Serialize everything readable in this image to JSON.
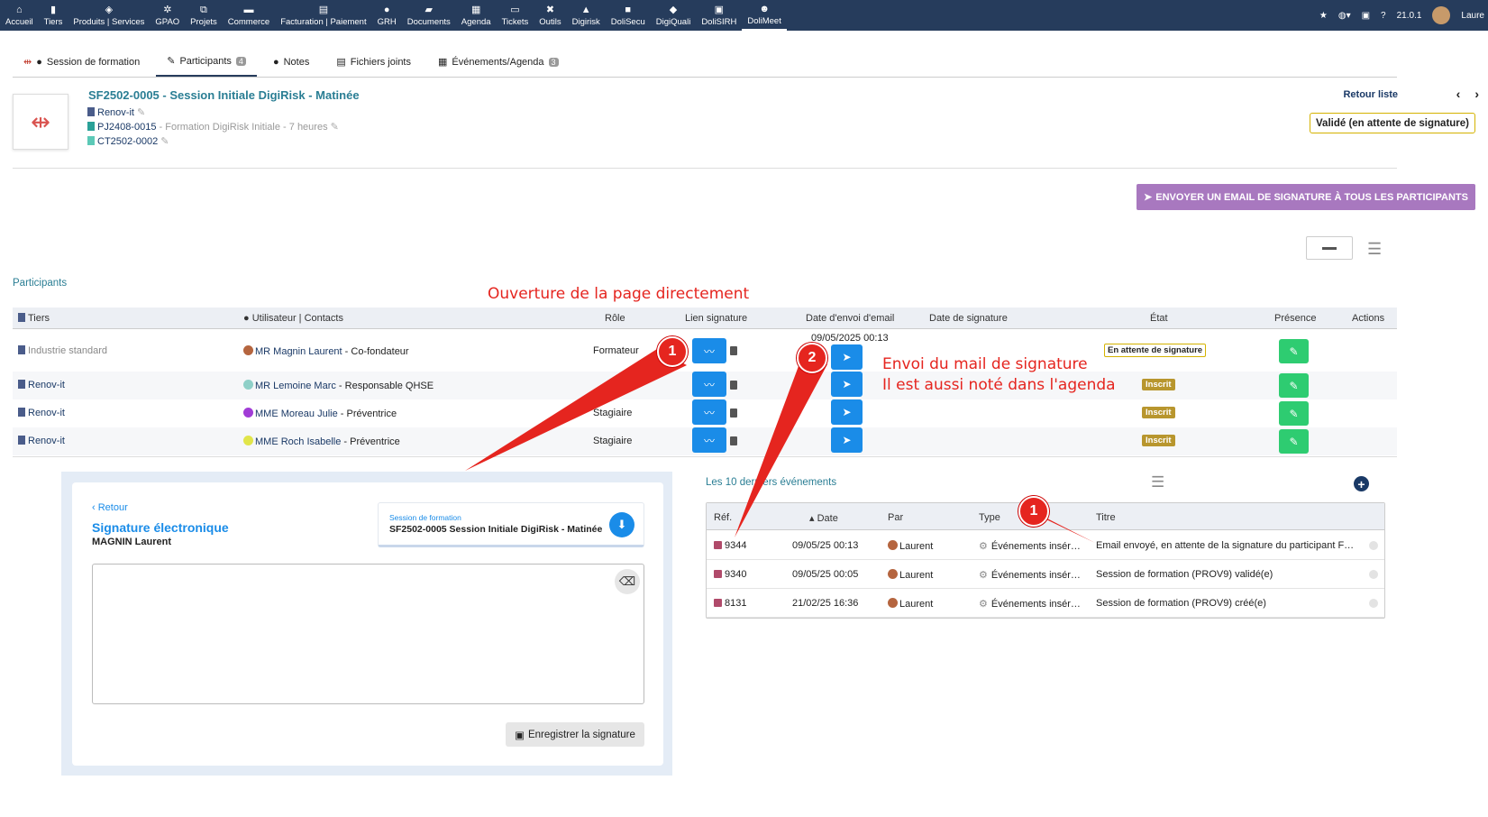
{
  "topbar": {
    "items": [
      {
        "label": "Accueil",
        "icon": "home-icon",
        "glyph": "⌂"
      },
      {
        "label": "Tiers",
        "icon": "building-icon",
        "glyph": "▮"
      },
      {
        "label": "Produits | Services",
        "icon": "cube-icon",
        "glyph": "◈"
      },
      {
        "label": "GPAO",
        "icon": "cogs-icon",
        "glyph": "✲"
      },
      {
        "label": "Projets",
        "icon": "sitemap-icon",
        "glyph": "⧉"
      },
      {
        "label": "Commerce",
        "icon": "briefcase-icon",
        "glyph": "▬"
      },
      {
        "label": "Facturation | Paiement",
        "icon": "file-invoice-icon",
        "glyph": "▤"
      },
      {
        "label": "GRH",
        "icon": "user-tie-icon",
        "glyph": "●"
      },
      {
        "label": "Documents",
        "icon": "folder-icon",
        "glyph": "▰"
      },
      {
        "label": "Agenda",
        "icon": "calendar-icon",
        "glyph": "▦"
      },
      {
        "label": "Tickets",
        "icon": "ticket-icon",
        "glyph": "▭"
      },
      {
        "label": "Outils",
        "icon": "tools-icon",
        "glyph": "✖"
      },
      {
        "label": "Digirisk",
        "icon": "digirisk-icon",
        "glyph": "▲"
      },
      {
        "label": "DoliSecu",
        "icon": "lock-icon",
        "glyph": "■"
      },
      {
        "label": "DigiQuali",
        "icon": "digiquali-icon",
        "glyph": "◆"
      },
      {
        "label": "DoliSIRH",
        "icon": "id-card-icon",
        "glyph": "▣"
      },
      {
        "label": "DoliMeet",
        "icon": "people-icon",
        "glyph": "☻"
      }
    ],
    "version": "21.0.1",
    "user": "Laure"
  },
  "tabs": [
    {
      "label": "Session de formation",
      "badge": ""
    },
    {
      "label": "Participants",
      "badge": "4"
    },
    {
      "label": "Notes",
      "badge": ""
    },
    {
      "label": "Fichiers joints",
      "badge": ""
    },
    {
      "label": "Événements/Agenda",
      "badge": "3"
    }
  ],
  "header": {
    "title": "SF2502-0005 - Session Initiale DigiRisk - Matinée",
    "thirdparty": "Renov-it",
    "project_ref": "PJ2408-0015",
    "project_label": " - Formation DigiRisk Initiale - 7 heures",
    "contract": "CT2502-0002",
    "back_list": "Retour liste",
    "status": "Validé (en attente de signature)"
  },
  "actions": {
    "email_all": "ENVOYER UN EMAIL DE SIGNATURE À TOUS LES PARTICIPANTS"
  },
  "participants": {
    "label": "Participants",
    "annotation": "Ouverture de la page directement",
    "columns": [
      "Tiers",
      "Utilisateur | Contacts",
      "Rôle",
      "Lien signature",
      "Date d'envoi d'email",
      "Date de signature",
      "État",
      "Présence",
      "Actions"
    ],
    "rows": [
      {
        "tiers": "Industrie standard",
        "contact": "MR Magnin Laurent",
        "contact_suffix": " - Co-fondateur",
        "role": "Formateur",
        "email_date": "09/05/2025 00:13",
        "sign_date": "",
        "state": "En attente de signature",
        "avatar_color": "#b5653f"
      },
      {
        "tiers": "Renov-it",
        "contact": "MR Lemoine Marc",
        "contact_suffix": " - Responsable QHSE",
        "role": "",
        "email_date": "",
        "sign_date": "",
        "state": "Inscrit",
        "avatar_color": "#8fd0c8"
      },
      {
        "tiers": "Renov-it",
        "contact": "MME Moreau Julie",
        "contact_suffix": " - Préventrice",
        "role": "Stagiaire",
        "email_date": "",
        "sign_date": "",
        "state": "Inscrit",
        "avatar_color": "#a13cd6"
      },
      {
        "tiers": "Renov-it",
        "contact": "MME Roch Isabelle",
        "contact_suffix": " - Préventrice",
        "role": "Stagiaire",
        "email_date": "",
        "sign_date": "",
        "state": "Inscrit",
        "avatar_color": "#e1e54a"
      }
    ]
  },
  "annotation_mail": {
    "line1": "Envoi du mail de signature",
    "line2": "Il est aussi noté dans l'agenda"
  },
  "markers": {
    "one": "1",
    "two": "2"
  },
  "signature": {
    "back": "Retour",
    "title": "Signature électronique",
    "name": "MAGNIN Laurent",
    "session_label": "Session de formation",
    "session_title": "SF2502-0005 Session Initiale DigiRisk - Matinée",
    "save": "Enregistrer la signature"
  },
  "events": {
    "label": "Les 10 derniers événements",
    "columns": [
      "Réf.",
      "Date",
      "Par",
      "Type",
      "Titre"
    ],
    "rows": [
      {
        "ref": "9344",
        "date": "09/05/25 00:13",
        "by": "Laurent",
        "type": "Événements insér…",
        "title": "Email envoyé, en attente de la signature du participant F…"
      },
      {
        "ref": "9340",
        "date": "09/05/25 00:05",
        "by": "Laurent",
        "type": "Événements insér…",
        "title": "Session de formation (PROV9) validé(e)"
      },
      {
        "ref": "8131",
        "date": "21/02/25 16:36",
        "by": "Laurent",
        "type": "Événements insér…",
        "title": "Session de formation (PROV9) créé(e)"
      }
    ]
  }
}
